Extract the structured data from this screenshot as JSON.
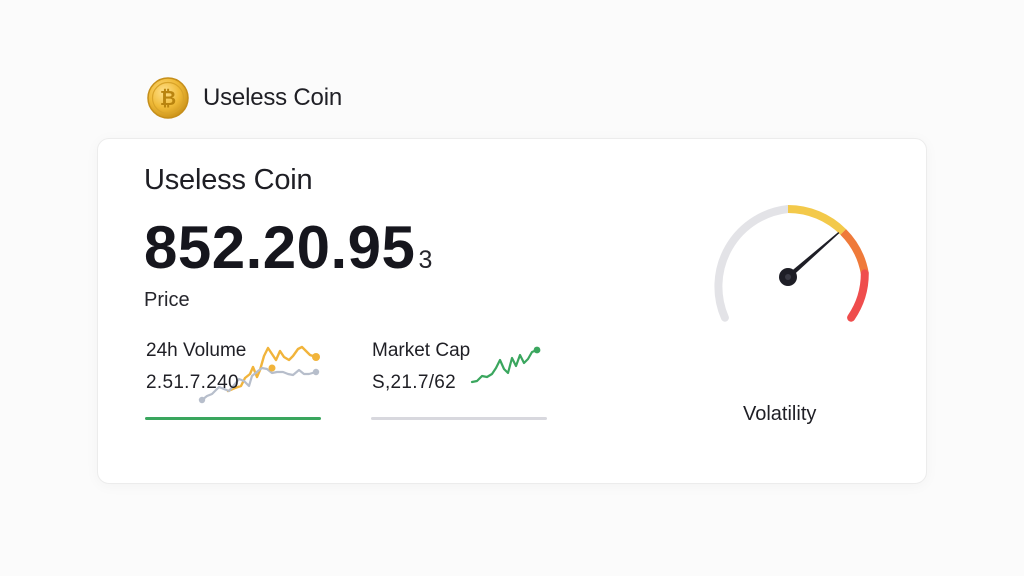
{
  "header": {
    "brand_name": "Useless Coin",
    "logo_icon": "bitcoin-coin-icon"
  },
  "card": {
    "title": "Useless Coin",
    "price_value": "852.20.95",
    "price_suffix": "3",
    "price_label": "Price",
    "stats": [
      {
        "label": "24h Volume",
        "value": "2.51.7.240",
        "spark_icon": "sparkline-multi-series",
        "bar_color": "#3aa65e"
      },
      {
        "label": "Market Cap",
        "value": "S,21.7/62",
        "spark_icon": "sparkline-green",
        "bar_color": "#d8d8de"
      }
    ],
    "gauge": {
      "label": "Volatility",
      "icon": "gauge-speedometer-icon",
      "level": 0.82,
      "colors": {
        "track": "#e3e3e7",
        "low": "#f3c94a",
        "mid": "#ef7a3a",
        "high": "#ef4d4d",
        "needle": "#1e1e26"
      }
    }
  },
  "colors": {
    "coin_gold": "#e9b634",
    "spark_gold": "#f1b43b",
    "spark_gray": "#b7becb",
    "spark_green": "#3aa65e"
  }
}
